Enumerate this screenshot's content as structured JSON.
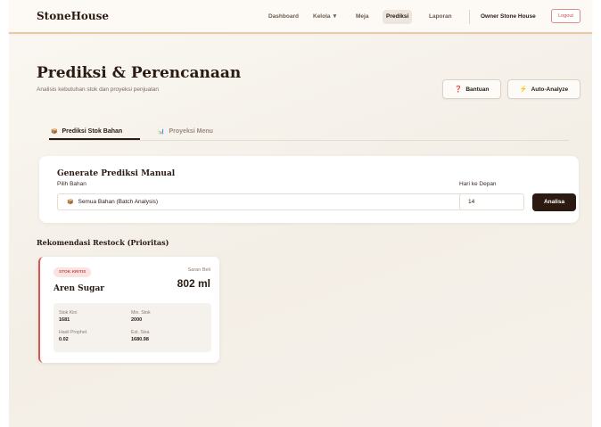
{
  "brand": "StoneHouse",
  "nav": {
    "items": [
      "Dashboard",
      "Kelola ▼",
      "Meja",
      "Prediksi",
      "Laporan"
    ],
    "active": "Prediksi",
    "owner": "Owner Stone House",
    "logout": "Logout"
  },
  "header": {
    "title": "Prediksi & Perencanaan",
    "subtitle": "Analisis kebutuhan stok dan proyeksi penjualan",
    "help_label": "Bantuan",
    "auto_label": "Auto-Analyze"
  },
  "tabs": [
    {
      "icon": "📦",
      "label": "Prediksi Stok Bahan",
      "active": true
    },
    {
      "icon": "📊",
      "label": "Proyeksi Menu",
      "active": false
    }
  ],
  "manual": {
    "title": "Generate Prediksi Manual",
    "bahan_label": "Pilih Bahan",
    "bahan_icon": "📦",
    "bahan_value": "Semua Bahan (Batch Analysis)",
    "days_label": "Hari ke Depan",
    "days_value": "14",
    "submit_label": "Analisa"
  },
  "restock": {
    "title": "Rekomendasi Restock (Prioritas)",
    "items": [
      {
        "badge": "STOK KRITIS",
        "saran_label": "Saran Beli",
        "saran_value": "802 ml",
        "name": "Aren Sugar",
        "stok_kini_label": "Stok Kini",
        "stok_kini": "1681",
        "min_stok_label": "Min. Stok",
        "min_stok": "2000",
        "hasil_label": "Hasil Prophet",
        "hasil": "0.02",
        "sisa_label": "Est. Sisa",
        "sisa": "1680.98"
      }
    ]
  },
  "colors": {
    "accent_dark": "#2c1a10",
    "critical": "#d9534f",
    "nav_border": "#e9c9a6"
  }
}
